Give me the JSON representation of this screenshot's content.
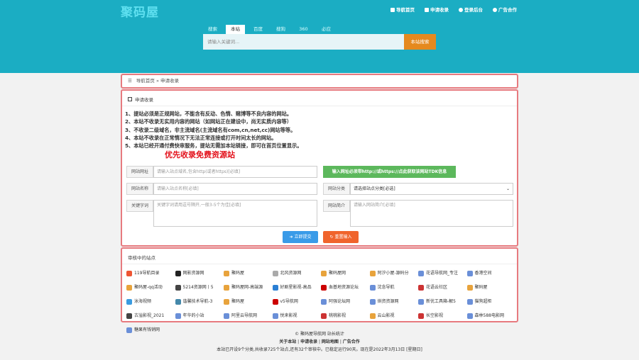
{
  "logo": "聚码屋",
  "topnav": [
    "导航首页",
    "申请收录",
    "登录后台",
    "广告合作"
  ],
  "tabs": [
    "搜索",
    "本站",
    "百度",
    "搜狗",
    "360",
    "必应"
  ],
  "search": {
    "placeholder": "请输入关键词...",
    "button": "本站搜索"
  },
  "breadcrumb": {
    "home": "导航首页",
    "sep": "»",
    "current": "申请收录"
  },
  "form": {
    "title": "申请收录",
    "rules": [
      "1、提站必须是正规网站，不能含有反动、色情、赌博等不良内容的网站。",
      "2、本站不收录无实用内容的网站（如网站正在建设中，尚无实质内容等）",
      "3、不收录二级域名，非主流域名(主流域名有com,cn,net,cc)网站等等。",
      "4、本站不收录在正常情况下无法正常连接或打开时间太长的网站。",
      "5、本站已经开通付费快审服务，提站无需加本站链接，即可在首页位置显示。"
    ],
    "priority": "优先收录免费资源站",
    "url_label": "网站网址",
    "url_placeholder": "请输入站点域名,包含http(或者https)[必填]",
    "fetch_btn": "输入网址必须带http://或https://点此获取该网站TDK信息",
    "name_label": "网站名称",
    "name_placeholder": "请输入站点名称[必填]",
    "cat_label": "网站分类",
    "cat_value": "请选择站点分类[必选]",
    "kw_label": "关键字词",
    "kw_placeholder": "关键字词请用逗号隔开,一般3-5个为佳[必填]",
    "desc_label": "网站简介",
    "desc_placeholder": "请输入网站简介[必填]",
    "submit": "立即提交",
    "reset": "重置输入"
  },
  "review": {
    "title": "审核中的站点",
    "sites": [
      [
        "119导航目录",
        "#e53"
      ],
      [
        "网影资源网",
        "#222"
      ],
      [
        "聚码屋",
        "#e8a33c"
      ],
      [
        "北风资源网",
        "#aaa"
      ],
      [
        "聚码屋网",
        "#e8a33c"
      ],
      [
        "阿汐小屋-源码分",
        "#e8a33c"
      ],
      [
        "花语导航网_专注",
        "#6a8fd8"
      ],
      [
        "香港空间",
        "#6a8fd8"
      ],
      [
        "聚码屋-qq活动",
        "#e8a33c"
      ],
      [
        "5214资源网丨5",
        "#444"
      ],
      [
        "聚码屋网-高端源",
        "#e8a33c"
      ],
      [
        "好剧星影视-高品",
        "#2a7fd4"
      ],
      [
        "血基地资源论坛",
        "#c00"
      ],
      [
        "沈念导航",
        "#6a8fd8"
      ],
      [
        "花语云社区",
        "#c33"
      ],
      [
        "聚码屋",
        "#e8a33c"
      ],
      [
        "泳海视频",
        "#3a9be0"
      ],
      [
        "谐馨技术导航-3",
        "#48a"
      ],
      [
        "聚码屋",
        "#e8a33c"
      ],
      [
        "v5导航网",
        "#c00"
      ],
      [
        "阿强论坛网",
        "#6a8fd8"
      ],
      [
        "烘资资源网",
        "#6a8fd8"
      ],
      [
        "新优工具箱-解5",
        "#6a8fd8"
      ],
      [
        "猫狗超柜",
        "#6a8fd8"
      ],
      [
        "古溢影视_2021",
        "#444"
      ],
      [
        "年华的小站",
        "#6a8fd8"
      ],
      [
        "阿里云导航网",
        "#6a8fd8"
      ],
      [
        "悦来影视",
        "#6a8fd8"
      ],
      [
        "桃桃影视",
        "#c33"
      ],
      [
        "云山影视",
        "#e8a33c"
      ],
      [
        "长空影视",
        "#c33"
      ],
      [
        "森林588电影网",
        "#6a8fd8"
      ],
      [
        "糖果有钱销网",
        "#6a8fd8"
      ]
    ]
  },
  "footer": {
    "copy": "© 聚码屋导航网 站长统计",
    "links": [
      "关于本站",
      "申请收录",
      "网站地图",
      "广告合作"
    ],
    "stats": "本站已开设9个分类,共收录725个站点,还有32个审核中。已稳定运行90天。现在是2022年3月13日 [星期日]"
  }
}
